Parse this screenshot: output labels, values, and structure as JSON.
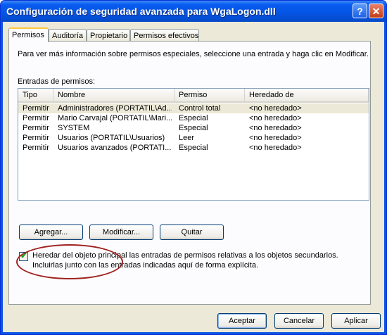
{
  "window": {
    "title": "Configuración de seguridad avanzada para WgaLogon.dll",
    "help_symbol": "?",
    "close_symbol": "✕"
  },
  "tabs": [
    {
      "label": "Permisos",
      "active": true
    },
    {
      "label": "Auditoría",
      "active": false
    },
    {
      "label": "Propietario",
      "active": false
    },
    {
      "label": "Permisos efectivos",
      "active": false
    }
  ],
  "panel": {
    "info_text": "Para ver más información sobre permisos especiales, seleccione una entrada y haga clic en Modificar.",
    "entries_label": "Entradas de permisos:",
    "columns": [
      "Tipo",
      "Nombre",
      "Permiso",
      "Heredado de"
    ],
    "rows": [
      [
        "Permitir",
        "Administradores (PORTATIL\\Ad...",
        "Control total",
        "<no heredado>"
      ],
      [
        "Permitir",
        "Mario Carvajal (PORTATIL\\Mari...",
        "Especial",
        "<no heredado>"
      ],
      [
        "Permitir",
        "SYSTEM",
        "Especial",
        "<no heredado>"
      ],
      [
        "Permitir",
        "Usuarios (PORTATIL\\Usuarios)",
        "Leer",
        "<no heredado>"
      ],
      [
        "Permitir",
        "Usuarios avanzados (PORTATI...",
        "Especial",
        "<no heredado>"
      ]
    ],
    "selected_row": 0,
    "buttons": {
      "add": "Agregar...",
      "edit": "Modificar...",
      "remove": "Quitar"
    },
    "inherit_checkbox": {
      "checked": true,
      "label": "Heredar del objeto principal las entradas de permisos relativas a los objetos secundarios. Incluirlas junto con las entradas indicadas aquí de forma explícita."
    }
  },
  "dialog_buttons": {
    "ok": "Aceptar",
    "cancel": "Cancelar",
    "apply": "Aplicar"
  },
  "colors": {
    "accent": "#0a54e3",
    "annotation": "#a0221f"
  }
}
